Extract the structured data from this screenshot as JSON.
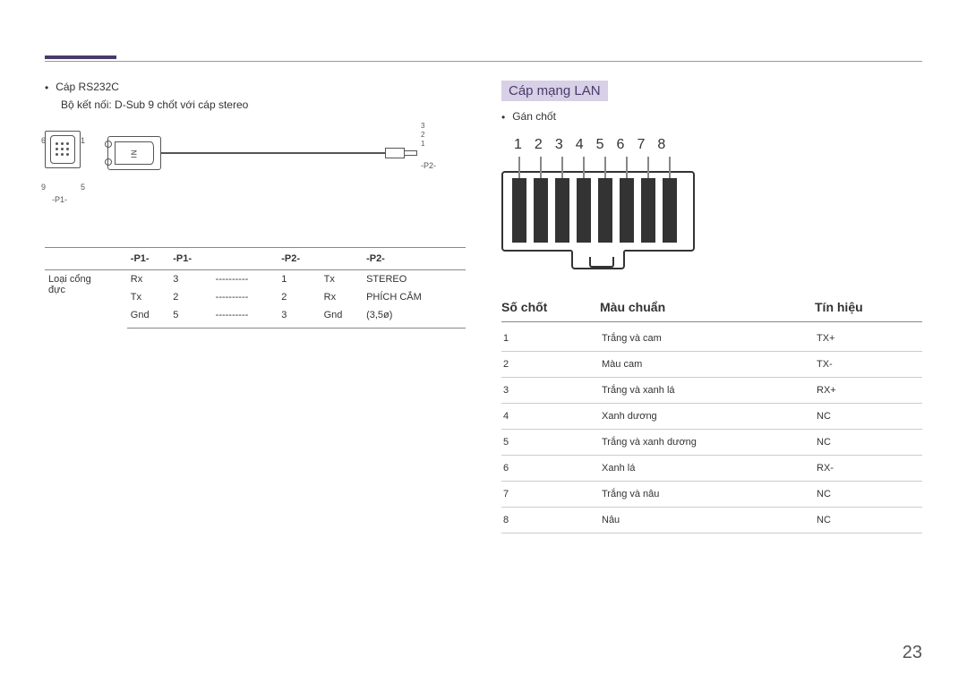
{
  "page_number": "23",
  "left": {
    "cable_title": "Cáp RS232C",
    "cable_desc": "Bộ kết nối: D-Sub 9 chốt với cáp stereo",
    "pin_labels": {
      "p6": "6",
      "p1": "1",
      "p9": "9",
      "p5": "5"
    },
    "p1_marker": "-P1-",
    "p2_marker": "-P2-",
    "jack_labels": [
      "3",
      "2",
      "1"
    ],
    "in_label": "IN",
    "table": {
      "headers": [
        "-P1-",
        "-P1-",
        "-P2-",
        "-P2-"
      ],
      "row_label_1": "Loại cổng",
      "row_label_2": "đực",
      "rows": [
        [
          "Rx",
          "3",
          "----------",
          "1",
          "Tx",
          "STEREO"
        ],
        [
          "Tx",
          "2",
          "----------",
          "2",
          "Rx",
          "PHÍCH CẮM"
        ],
        [
          "Gnd",
          "5",
          "----------",
          "3",
          "Gnd",
          "(3,5ø)"
        ]
      ]
    }
  },
  "right": {
    "section_title": "Cáp mạng LAN",
    "bullet": "Gán chốt",
    "pin_numbers": [
      "1",
      "2",
      "3",
      "4",
      "5",
      "6",
      "7",
      "8"
    ],
    "headers": {
      "c1": "Số chốt",
      "c2": "Màu chuẩn",
      "c3": "Tín hiệu"
    },
    "rows": [
      {
        "pin": "1",
        "color": "Trắng và cam",
        "signal": "TX+"
      },
      {
        "pin": "2",
        "color": "Màu cam",
        "signal": "TX-"
      },
      {
        "pin": "3",
        "color": "Trắng và xanh lá",
        "signal": "RX+"
      },
      {
        "pin": "4",
        "color": "Xanh dương",
        "signal": "NC"
      },
      {
        "pin": "5",
        "color": "Trắng và xanh dương",
        "signal": "NC"
      },
      {
        "pin": "6",
        "color": "Xanh lá",
        "signal": "RX-"
      },
      {
        "pin": "7",
        "color": "Trắng và nâu",
        "signal": "NC"
      },
      {
        "pin": "8",
        "color": "Nâu",
        "signal": "NC"
      }
    ]
  }
}
